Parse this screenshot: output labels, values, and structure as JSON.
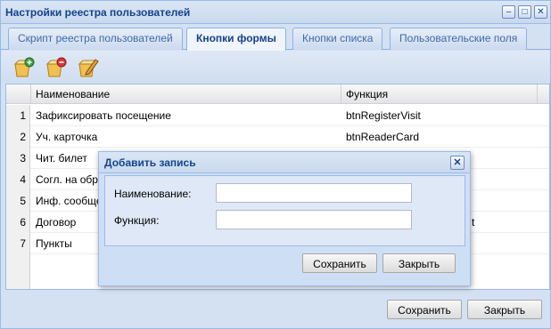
{
  "window": {
    "title": "Настройки реестра пользователей",
    "tools": {
      "minimize": "–",
      "maximize": "□",
      "close": "✕"
    }
  },
  "tabs": [
    {
      "label": "Скрипт реестра пользователей",
      "active": false
    },
    {
      "label": "Кнопки формы",
      "active": true
    },
    {
      "label": "Кнопки списка",
      "active": false
    },
    {
      "label": "Пользовательские поля",
      "active": false
    }
  ],
  "toolbar": {
    "icons": [
      "add-record-icon",
      "delete-record-icon",
      "edit-record-icon"
    ]
  },
  "grid": {
    "columns": [
      "Наименование",
      "Функция"
    ],
    "rows": [
      {
        "num": "1",
        "name": "Зафиксировать посещение",
        "func": "btnRegisterVisit"
      },
      {
        "num": "2",
        "name": "Уч. карточка",
        "func": "btnReaderCard"
      },
      {
        "num": "3",
        "name": "Чит. билет",
        "func": ""
      },
      {
        "num": "4",
        "name": "Согл. на обр",
        "func": ""
      },
      {
        "num": "5",
        "name": "Инф. сообще",
        "func": ""
      },
      {
        "num": "6",
        "name": "Договор",
        "func": "t"
      },
      {
        "num": "7",
        "name": "Пункты",
        "func": ""
      }
    ]
  },
  "footer": {
    "save_label": "Сохранить",
    "close_label": "Закрыть"
  },
  "dialog": {
    "title": "Добавить запись",
    "close_glyph": "✕",
    "fields": [
      {
        "label": "Наименование:",
        "value": ""
      },
      {
        "label": "Функция:",
        "value": ""
      }
    ],
    "save_label": "Сохранить",
    "close_label": "Закрыть"
  },
  "colors": {
    "title_text": "#15428b",
    "panel_bg": "#d4e1f2",
    "border": "#99bbe8"
  }
}
